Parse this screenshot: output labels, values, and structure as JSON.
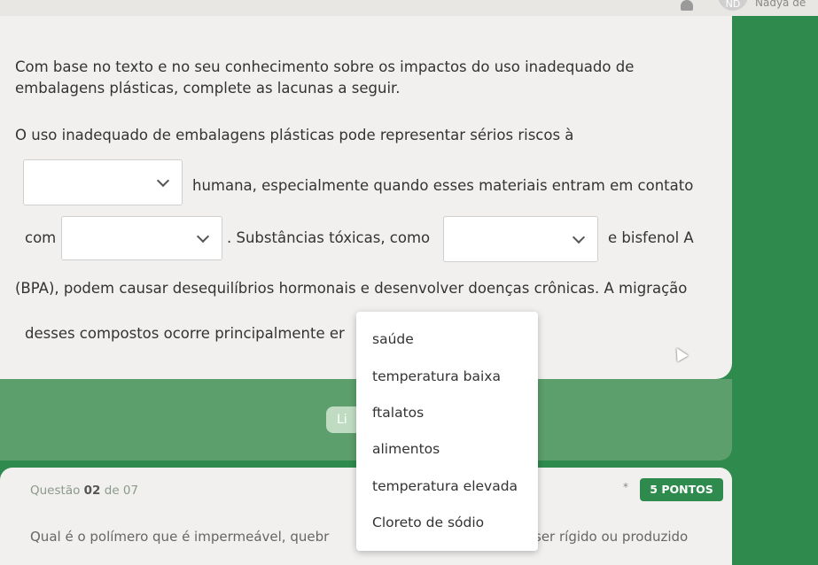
{
  "header": {
    "avatar_initials": "ND",
    "user_name": "Nadya de"
  },
  "question1": {
    "prompt_line1": "Com base no texto e no seu conhecimento sobre os impactos do uso inadequado de",
    "prompt_line2": "embalagens plásticas, complete as lacunas a seguir.",
    "sentence_part1": "O uso inadequado de embalagens plásticas pode representar sérios riscos à",
    "sentence_part2": "humana, especialmente quando esses materiais entram em contato",
    "sentence_part3": "com",
    "sentence_part4": ". Substâncias tóxicas, como",
    "sentence_part5": "e bisfenol A",
    "sentence_part6": "(BPA), podem causar desequilíbrios hormonais e desenvolver doenças crônicas. A migração",
    "sentence_part7": "desses compostos ocorre principalmente er",
    "blanks": [
      "",
      "",
      ""
    ],
    "options": [
      "saúde",
      "temperatura baixa",
      "ftalatos",
      "alimentos",
      "temperatura elevada",
      "Cloreto de sódio"
    ]
  },
  "banner": {
    "list_button_label": "Li"
  },
  "question2": {
    "label_prefix": "Questão",
    "number": "02",
    "label_suffix": "de 07",
    "required_mark": "*",
    "points": "5 PONTOS",
    "text_left": "Qual é o polímero que é impermeável, quebr",
    "text_right": "ser rígido ou produzido"
  },
  "colors": {
    "brand_green": "#2f8a4e",
    "banner_green": "#5c9e6c",
    "card_bg": "#f1f0ee"
  }
}
